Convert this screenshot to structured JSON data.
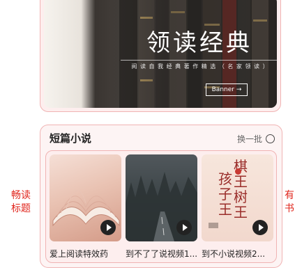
{
  "banner": {
    "title": "领读经典",
    "subtitle": "阅 读 自 我 经 典 著 作 精 选 （ 名 家 领 读 ）",
    "tag": "Banner →"
  },
  "section": {
    "title": "短篇小说",
    "refresh_label": "换一批"
  },
  "books": [
    {
      "title": "爱上阅读特效药"
    },
    {
      "title": "到不了了说视频1..."
    },
    {
      "title": "到不小说视频2..."
    }
  ],
  "cover3": {
    "line1": "棋王 树王",
    "line2": "孩子王"
  },
  "annotations": {
    "left": [
      "畅读",
      "标题"
    ],
    "right": [
      "有",
      "书"
    ]
  },
  "colors": {
    "accent": "#e0241b",
    "card_border": "#f0b3b3"
  }
}
